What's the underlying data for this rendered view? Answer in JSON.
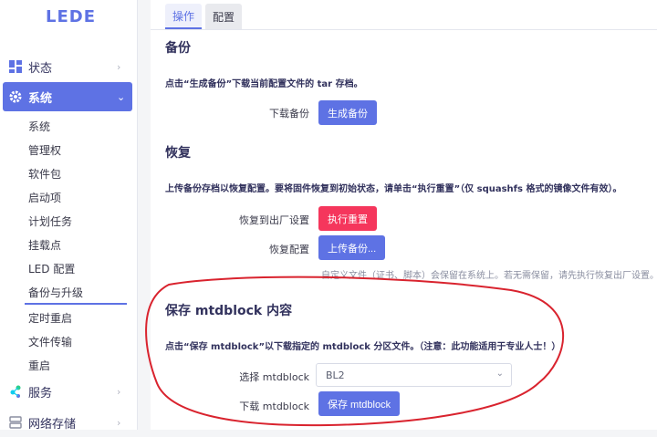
{
  "logo": "LEDE",
  "sidebar": {
    "items": [
      {
        "label": "状态",
        "icon": "dashboard-icon"
      },
      {
        "label": "系统",
        "icon": "gear-icon"
      },
      {
        "label": "服务",
        "icon": "share-icon"
      },
      {
        "label": "网络存储",
        "icon": "storage-icon"
      }
    ],
    "subitems": [
      "系统",
      "管理权",
      "软件包",
      "启动项",
      "计划任务",
      "挂载点",
      "LED 配置",
      "备份与升级",
      "定时重启",
      "文件传输",
      "重启"
    ]
  },
  "tabs": [
    "操作",
    "配置"
  ],
  "backup": {
    "title": "备份",
    "desc": "点击“生成备份”下载当前配置文件的 tar 存档。",
    "label": "下载备份",
    "button": "生成备份"
  },
  "restore": {
    "title": "恢复",
    "desc": "上传备份存档以恢复配置。要将固件恢复到初始状态，请单击“执行重置”（仅 squashfs 格式的镜像文件有效）。",
    "reset_label": "恢复到出厂设置",
    "reset_button": "执行重置",
    "restore_label": "恢复配置",
    "upload_button": "上传备份...",
    "hint": "自定义文件（证书、脚本）会保留在系统上。若无需保留，请先执行恢复出厂设置。"
  },
  "mtd": {
    "title": "保存 mtdblock 内容",
    "desc": "点击“保存 mtdblock”以下载指定的 mtdblock 分区文件。（注意：此功能适用于专业人士！）",
    "select_label": "选择 mtdblock",
    "select_value": "BL2",
    "download_label": "下载 mtdblock",
    "save_button": "保存 mtdblock"
  },
  "colors": {
    "primary": "#5e72e4",
    "danger": "#f5365c",
    "annotation": "#d9232e"
  }
}
